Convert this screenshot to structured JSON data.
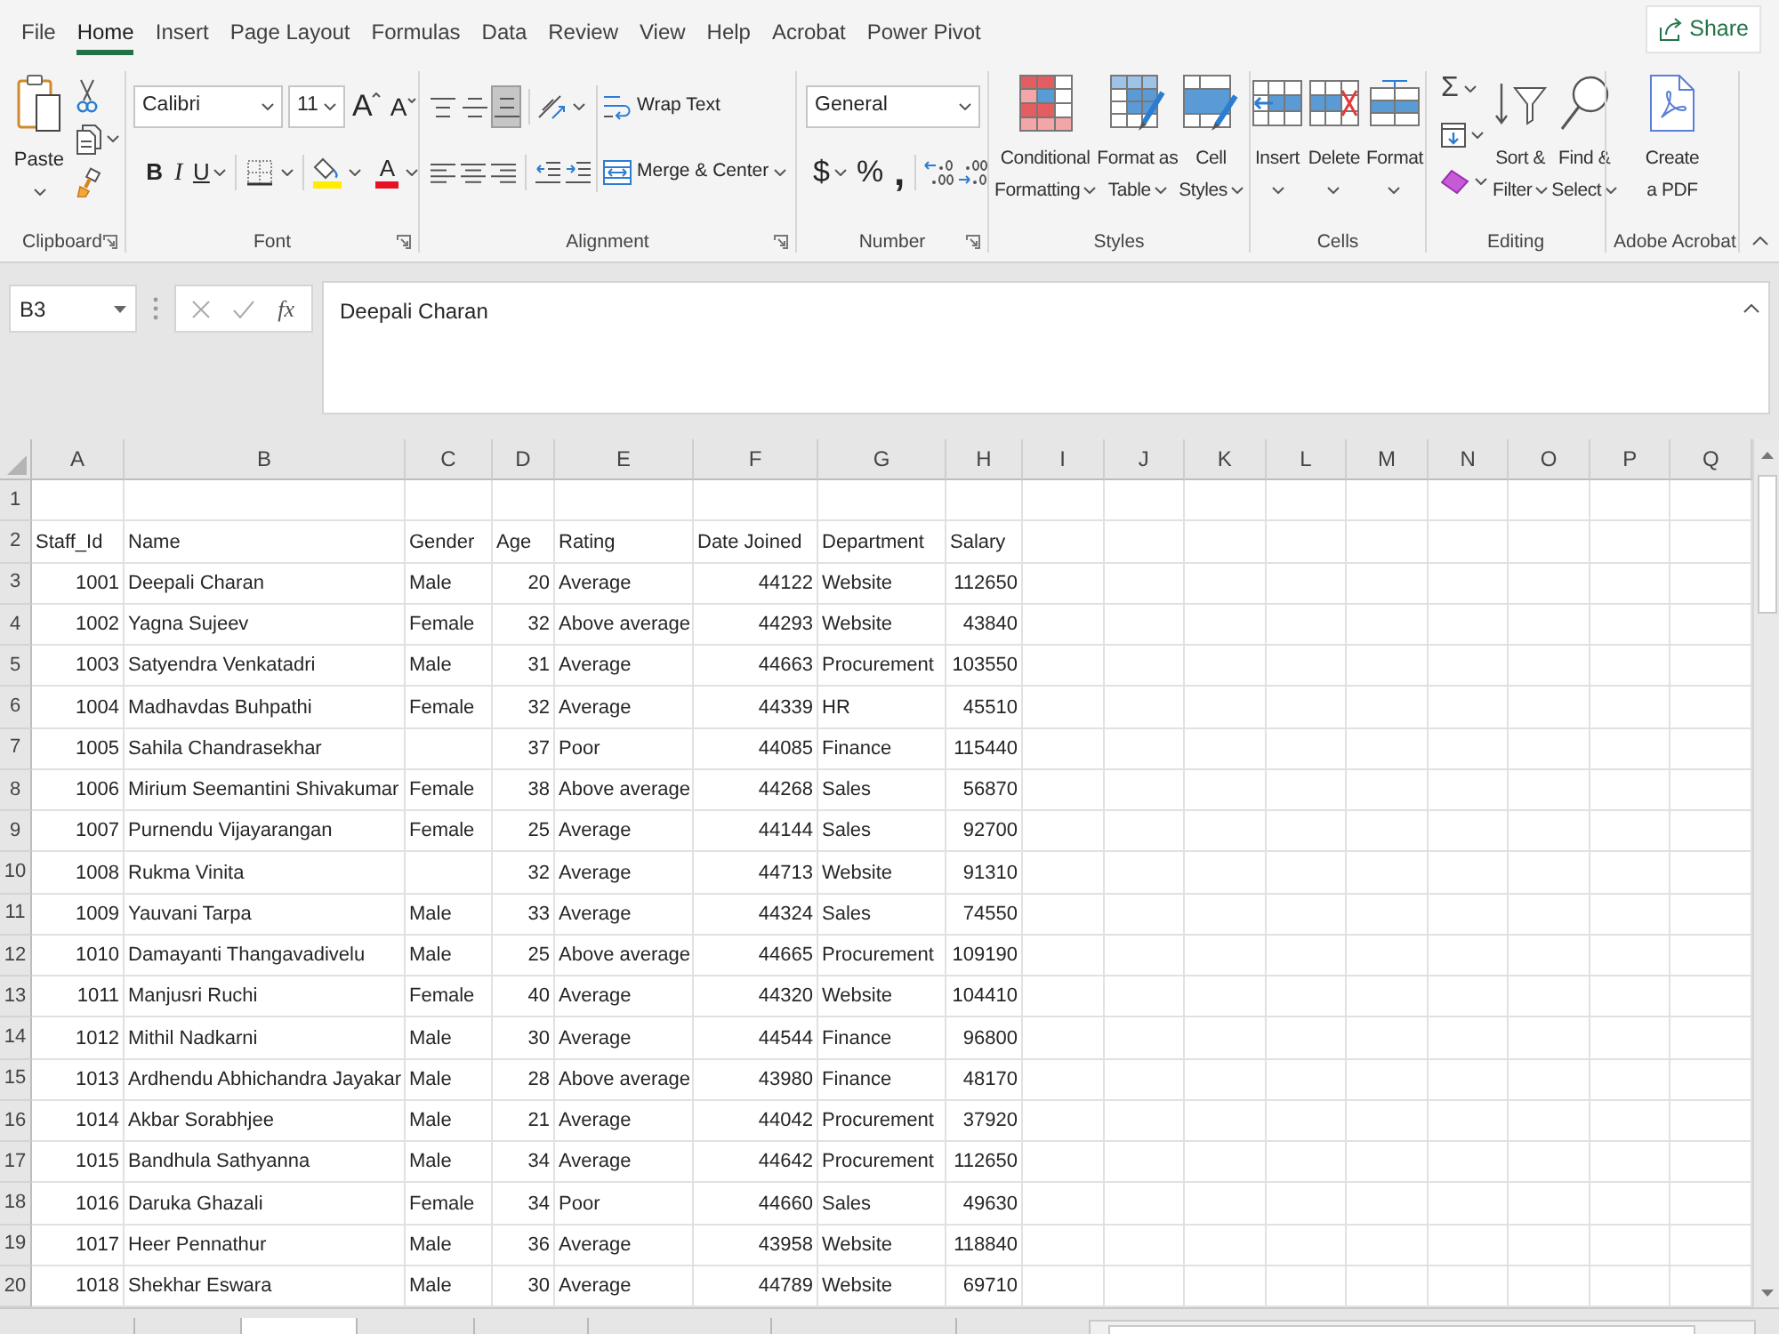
{
  "menu_tabs": [
    {
      "label": "File",
      "selected": false
    },
    {
      "label": "Home",
      "selected": true
    },
    {
      "label": "Insert",
      "selected": false
    },
    {
      "label": "Page Layout",
      "selected": false
    },
    {
      "label": "Formulas",
      "selected": false
    },
    {
      "label": "Data",
      "selected": false
    },
    {
      "label": "Review",
      "selected": false
    },
    {
      "label": "View",
      "selected": false
    },
    {
      "label": "Help",
      "selected": false
    },
    {
      "label": "Acrobat",
      "selected": false
    },
    {
      "label": "Power Pivot",
      "selected": false
    }
  ],
  "share_button": {
    "label": "Share"
  },
  "ribbon": {
    "clipboard": {
      "label": "Clipboard",
      "paste": "Paste"
    },
    "font": {
      "label": "Font",
      "font_name": "Calibri",
      "font_size": "11",
      "grow_font": "A",
      "shrink_font": "A",
      "bold": "B",
      "italic": "I",
      "underline": "U",
      "font_color": "A"
    },
    "alignment": {
      "label": "Alignment",
      "vertical_align": [
        {
          "kind": "top",
          "selected": false
        },
        {
          "kind": "middle",
          "selected": false
        },
        {
          "kind": "bottom",
          "selected": true
        }
      ],
      "wrap_text": "Wrap Text",
      "merge_center": "Merge & Center"
    },
    "number": {
      "label": "Number",
      "format": "General",
      "currency": "$",
      "percent": "%",
      "comma": ","
    },
    "styles": {
      "label": "Styles",
      "buttons": [
        {
          "kind": "conditional",
          "label": "Conditional\nFormatting"
        },
        {
          "kind": "table",
          "label": "Format as\nTable"
        },
        {
          "kind": "cell_styles",
          "label": "Cell\nStyles"
        }
      ]
    },
    "cells": {
      "label": "Cells",
      "buttons": [
        {
          "kind": "insert",
          "label": "Insert"
        },
        {
          "kind": "delete",
          "label": "Delete"
        },
        {
          "kind": "format",
          "label": "Format"
        }
      ]
    },
    "editing": {
      "label": "Editing",
      "autosum": "Σ",
      "buttons": [
        {
          "kind": "sort",
          "label": "Sort &\nFilter"
        },
        {
          "kind": "find",
          "label": "Find &\nSelect"
        }
      ]
    },
    "acrobat": {
      "label": "Adobe Acrobat",
      "create_pdf": "Create\na PDF"
    }
  },
  "formula_bar": {
    "name_box": "B3",
    "function_button": "fx",
    "formula": "Deepali Charan"
  },
  "sheet": {
    "columns": [
      "A",
      "B",
      "C",
      "D",
      "E",
      "F",
      "G",
      "H",
      "I",
      "J",
      "K",
      "L",
      "M",
      "N",
      "O",
      "P",
      "Q"
    ],
    "rows": [
      {
        "number": "1"
      },
      {
        "number": "2",
        "cells": {
          "A": "Staff_Id",
          "B": "Name",
          "C": "Gender",
          "D": "Age",
          "E": "Rating",
          "F": "Date Joined",
          "G": "Department",
          "H": "Salary"
        }
      },
      {
        "number": "3",
        "cells": {
          "A": "1001",
          "B": "Deepali Charan",
          "C": "Male",
          "D": "20",
          "E": "Average",
          "F": "44122",
          "G": "Website",
          "H": "112650"
        }
      },
      {
        "number": "4",
        "cells": {
          "A": "1002",
          "B": "Yagna Sujeev",
          "C": "Female",
          "D": "32",
          "E": "Above average",
          "F": "44293",
          "G": "Website",
          "H": "43840"
        }
      },
      {
        "number": "5",
        "cells": {
          "A": "1003",
          "B": "Satyendra Venkatadri",
          "C": "Male",
          "D": "31",
          "E": "Average",
          "F": "44663",
          "G": "Procurement",
          "H": "103550"
        }
      },
      {
        "number": "6",
        "cells": {
          "A": "1004",
          "B": "Madhavdas Buhpathi",
          "C": "Female",
          "D": "32",
          "E": "Average",
          "F": "44339",
          "G": "HR",
          "H": "45510"
        }
      },
      {
        "number": "7",
        "cells": {
          "A": "1005",
          "B": "Sahila Chandrasekhar",
          "D": "37",
          "E": "Poor",
          "F": "44085",
          "G": "Finance",
          "H": "115440"
        }
      },
      {
        "number": "8",
        "cells": {
          "A": "1006",
          "B": "Mirium Seemantini Shivakumar",
          "C": "Female",
          "D": "38",
          "E": "Above average",
          "F": "44268",
          "G": "Sales",
          "H": "56870"
        }
      },
      {
        "number": "9",
        "cells": {
          "A": "1007",
          "B": "Purnendu Vijayarangan",
          "C": "Female",
          "D": "25",
          "E": "Average",
          "F": "44144",
          "G": "Sales",
          "H": "92700"
        }
      },
      {
        "number": "10",
        "cells": {
          "A": "1008",
          "B": "Rukma Vinita",
          "D": "32",
          "E": "Average",
          "F": "44713",
          "G": "Website",
          "H": "91310"
        }
      },
      {
        "number": "11",
        "cells": {
          "A": "1009",
          "B": "Yauvani Tarpa",
          "C": "Male",
          "D": "33",
          "E": "Average",
          "F": "44324",
          "G": "Sales",
          "H": "74550"
        }
      },
      {
        "number": "12",
        "cells": {
          "A": "1010",
          "B": "Damayanti Thangavadivelu",
          "C": "Male",
          "D": "25",
          "E": "Above average",
          "F": "44665",
          "G": "Procurement",
          "H": "109190"
        }
      },
      {
        "number": "13",
        "cells": {
          "A": "1011",
          "B": "Manjusri Ruchi",
          "C": "Female",
          "D": "40",
          "E": "Average",
          "F": "44320",
          "G": "Website",
          "H": "104410"
        }
      },
      {
        "number": "14",
        "cells": {
          "A": "1012",
          "B": "Mithil Nadkarni",
          "C": "Male",
          "D": "30",
          "E": "Average",
          "F": "44544",
          "G": "Finance",
          "H": "96800"
        }
      },
      {
        "number": "15",
        "cells": {
          "A": "1013",
          "B": "Ardhendu Abhichandra Jayakar",
          "C": "Male",
          "D": "28",
          "E": "Above average",
          "F": "43980",
          "G": "Finance",
          "H": "48170"
        }
      },
      {
        "number": "16",
        "cells": {
          "A": "1014",
          "B": "Akbar Sorabhjee",
          "C": "Male",
          "D": "21",
          "E": "Average",
          "F": "44042",
          "G": "Procurement",
          "H": "37920"
        }
      },
      {
        "number": "17",
        "cells": {
          "A": "1015",
          "B": "Bandhula Sathyanna",
          "C": "Male",
          "D": "34",
          "E": "Average",
          "F": "44642",
          "G": "Procurement",
          "H": "112650"
        }
      },
      {
        "number": "18",
        "cells": {
          "A": "1016",
          "B": "Daruka Ghazali",
          "C": "Female",
          "D": "34",
          "E": "Poor",
          "F": "44660",
          "G": "Sales",
          "H": "49630"
        }
      },
      {
        "number": "19",
        "cells": {
          "A": "1017",
          "B": "Heer Pennathur",
          "C": "Male",
          "D": "36",
          "E": "Average",
          "F": "43958",
          "G": "Website",
          "H": "118840"
        }
      },
      {
        "number": "20",
        "cells": {
          "A": "1018",
          "B": "Shekhar Eswara",
          "C": "Male",
          "D": "30",
          "E": "Average",
          "F": "44789",
          "G": "Website",
          "H": "69710"
        }
      }
    ]
  },
  "sheet_tabs": [
    {
      "selected": false
    },
    {
      "selected": true
    },
    {
      "selected": false
    },
    {
      "selected": false
    },
    {
      "selected": false
    },
    {
      "selected": false
    }
  ]
}
